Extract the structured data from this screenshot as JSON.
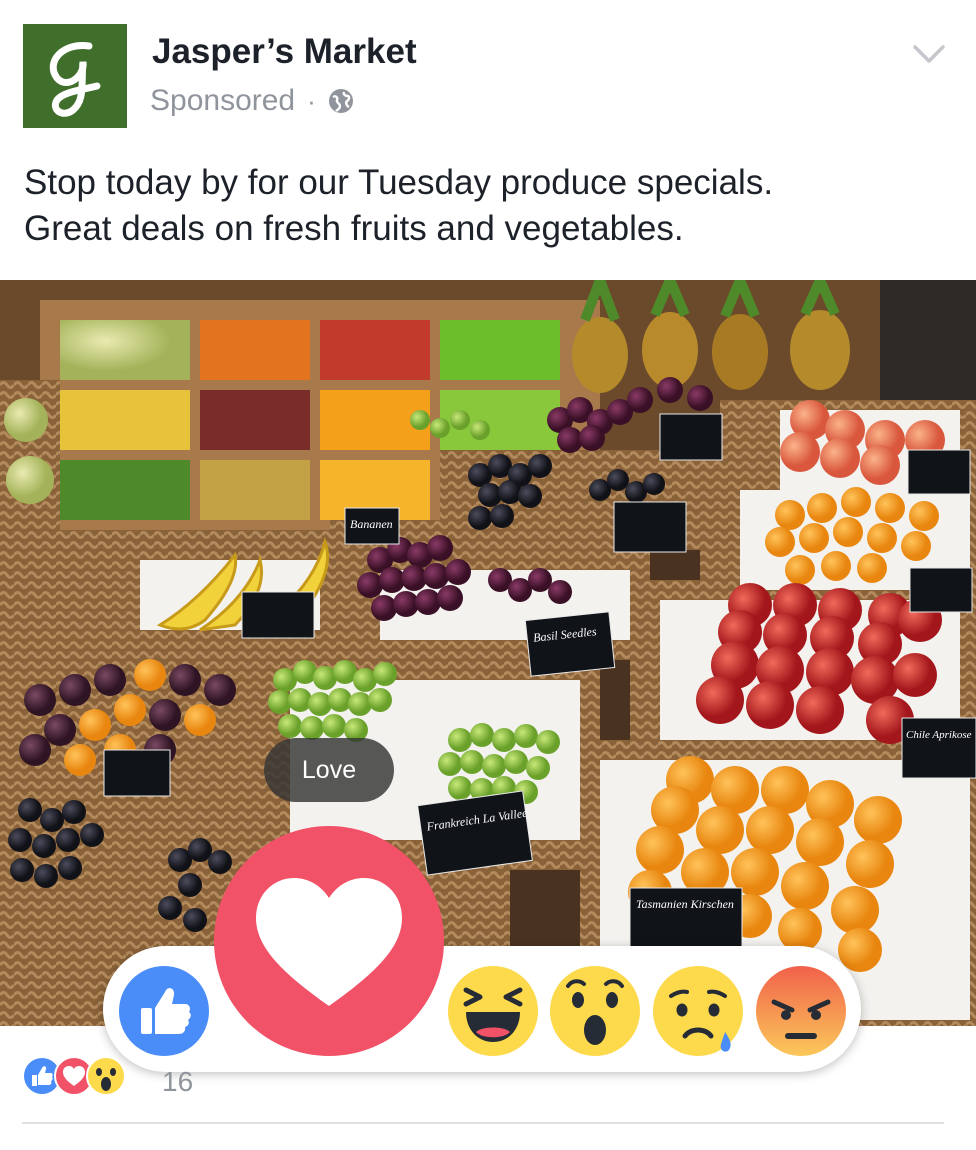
{
  "post": {
    "page_name": "Jasper’s Market",
    "sponsored_label": "Sponsored",
    "separator": "·",
    "privacy_icon": "globe-icon",
    "menu_icon": "chevron-down-icon",
    "text_line1": "Stop today by for our Tuesday produce specials.",
    "text_line2": "Great deals on fresh fruits and vegetables.",
    "avatar_letter": "g",
    "brand_color": "#3f6f2a"
  },
  "photo": {
    "description_icon": "market-produce-photo",
    "price_tags": [
      {
        "text": "Bananen"
      },
      {
        "text": "Basil Seedles"
      },
      {
        "text": "Frankreich La Vallee"
      },
      {
        "text": "Tasmanien Kirschen"
      },
      {
        "text": "Chile Aprikose"
      }
    ]
  },
  "reactions": {
    "hover_label": "Love",
    "options": [
      "like",
      "love",
      "haha",
      "wow",
      "sad",
      "angry"
    ],
    "colors": {
      "like": "#4a8df8",
      "love": "#f25268",
      "yellow": "#fdd94c",
      "angry_top": "#f1614b"
    }
  },
  "summary": {
    "icons": [
      "like-icon",
      "love-icon",
      "wow-icon"
    ],
    "count": "16"
  }
}
